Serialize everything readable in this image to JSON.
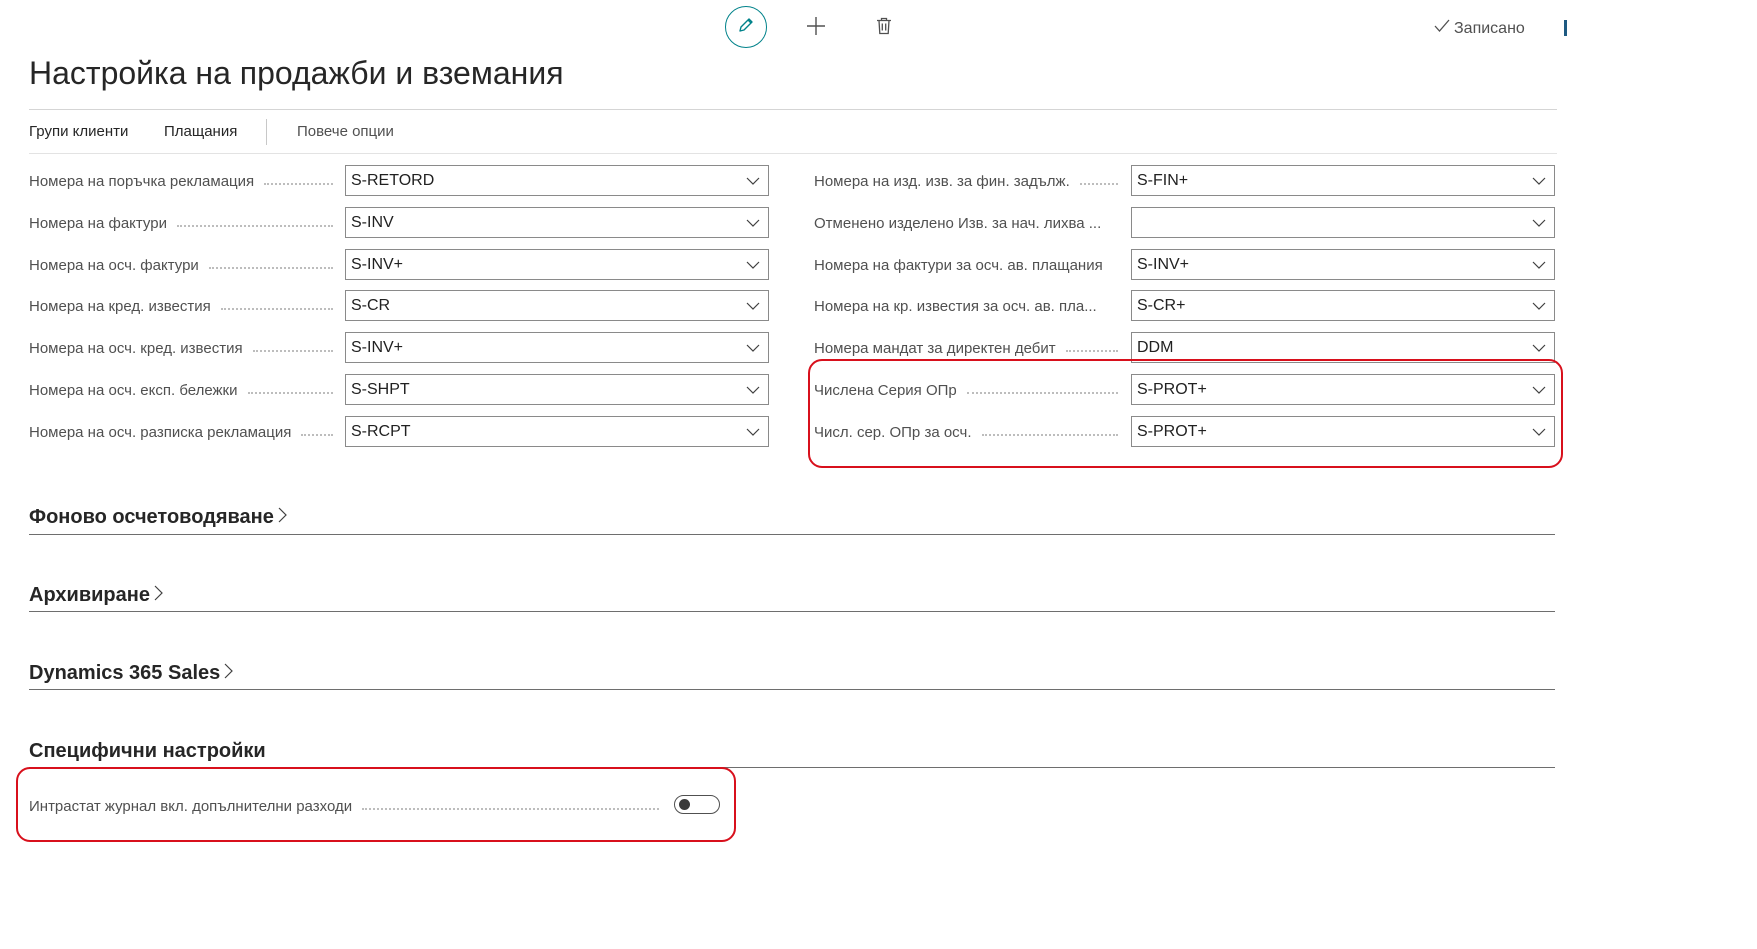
{
  "toolbar": {
    "edit_icon": "pencil-icon",
    "new_icon": "plus-icon",
    "delete_icon": "trash-icon",
    "saved_label": "Записано",
    "accent_color": "#00828a"
  },
  "page": {
    "title": "Настройка на продажби и вземания"
  },
  "actions": {
    "customer_groups": "Групи клиенти",
    "payments": "Плащания",
    "more_options": "Повече опции"
  },
  "left_fields": [
    {
      "label": "Номера на поръчка рекламация",
      "value": "S-RETORD"
    },
    {
      "label": "Номера на фактури",
      "value": "S-INV"
    },
    {
      "label": "Номера на осч. фактури",
      "value": "S-INV+"
    },
    {
      "label": "Номера на кред. известия",
      "value": "S-CR"
    },
    {
      "label": "Номера на осч. кред. известия",
      "value": "S-INV+"
    },
    {
      "label": "Номера на осч. експ. бележки",
      "value": "S-SHPT"
    },
    {
      "label": "Номера на осч. разписка рекламация",
      "value": "S-RCPT"
    }
  ],
  "right_fields": [
    {
      "label": "Номера на изд. изв. за фин. задълж.",
      "value": "S-FIN+"
    },
    {
      "label": "Отменено изделено Изв. за нач. лихва ...",
      "value": ""
    },
    {
      "label": "Номера на фактури за осч. ав. плащания",
      "value": "S-INV+"
    },
    {
      "label": "Номера на кр. известия за осч. ав. пла...",
      "value": "S-CR+"
    },
    {
      "label": "Номера мандат за директен дебит",
      "value": "DDM"
    },
    {
      "label": "Числена Серия ОПр",
      "value": "S-PROT+"
    },
    {
      "label": "Числ. сер. ОПр за осч.",
      "value": "S-PROT+"
    }
  ],
  "sections": {
    "background_posting": "Фоново осчетоводяване",
    "archiving": "Архивиране",
    "dynamics_sales": "Dynamics 365 Sales",
    "specific_settings": "Специфични настройки"
  },
  "specific": {
    "intrastat_label": "Интрастат журнал вкл. допълнителни разходи",
    "intrastat_on": false
  },
  "highlight_color": "#d8101c"
}
